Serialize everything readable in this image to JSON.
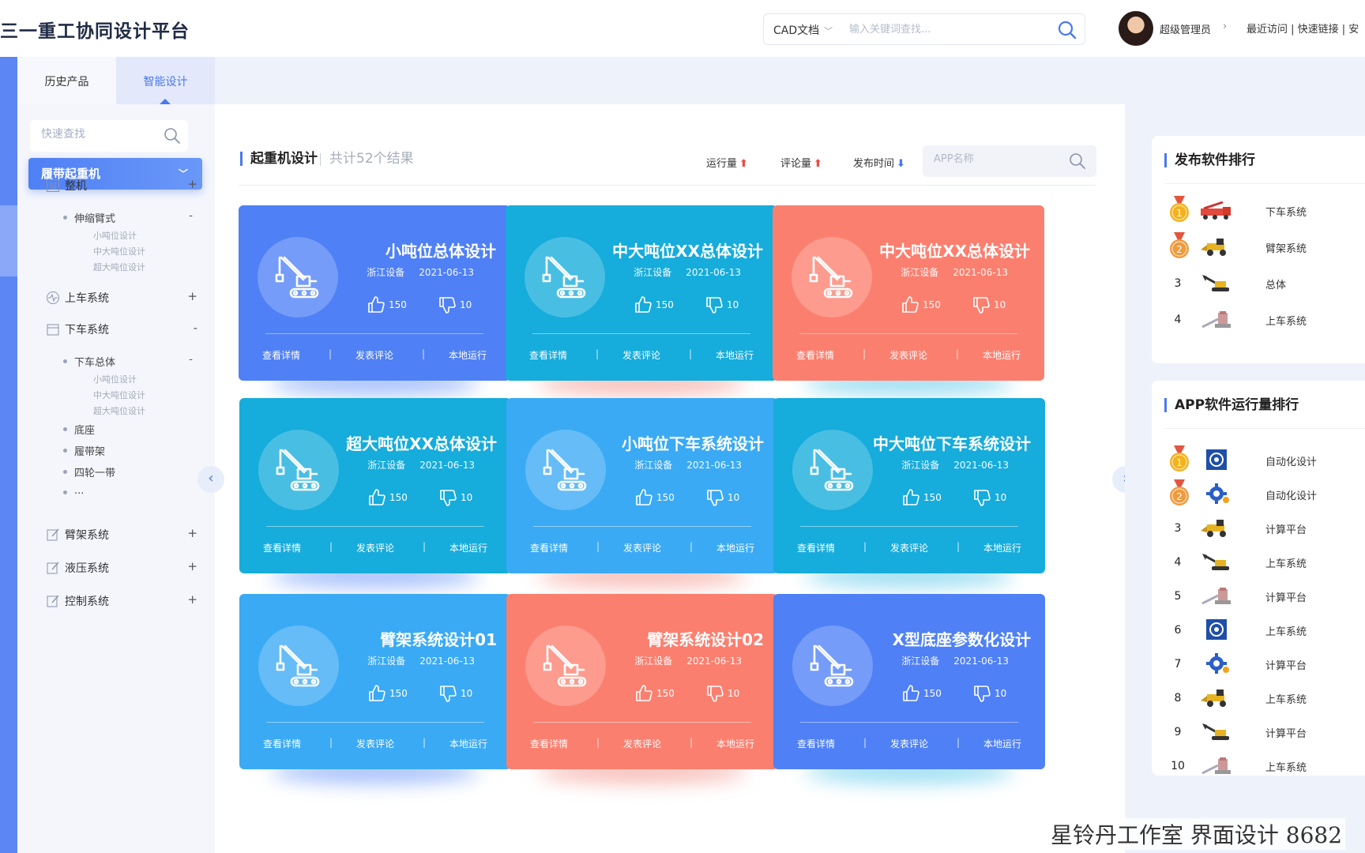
{
  "header": {
    "brand": "三一重工协同设计平台",
    "search_type": "CAD文档",
    "search_placeholder": "输入关键词查找...",
    "user_name": "超级管理员",
    "top_links": "最近访问 | 快速链接 | 安"
  },
  "sidebar": {
    "tabs": [
      {
        "label": "历史产品"
      },
      {
        "label": "智能设计"
      }
    ],
    "quick_search_placeholder": "快速查找",
    "active_category": "履带起重机",
    "groups": [
      {
        "label": "整机",
        "toggle": "+"
      },
      {
        "label": "上车系统",
        "toggle": "+"
      },
      {
        "label": "下车系统",
        "toggle": "-"
      },
      {
        "label": "臂架系统",
        "toggle": "+"
      },
      {
        "label": "液压系统",
        "toggle": "+"
      },
      {
        "label": "控制系统",
        "toggle": "+"
      }
    ],
    "zhengji_sub": {
      "label": "伸缩臂式",
      "toggle": "-",
      "leaves": [
        "小吨位设计",
        "中大吨位设计",
        "超大吨位设计"
      ]
    },
    "xiache_sub": {
      "label": "下车总体",
      "toggle": "-",
      "leaves": [
        "小吨位设计",
        "中大吨位设计",
        "超大吨位设计"
      ]
    },
    "xiache_others": [
      "底座",
      "履带架",
      "四轮一带",
      "..."
    ]
  },
  "main": {
    "section_title": "起重机设计",
    "result_count": "共计52个结果",
    "sorts": [
      {
        "label": "运行量",
        "arrow": "⬆",
        "color": "#f04a3e"
      },
      {
        "label": "评论量",
        "arrow": "⬆",
        "color": "#f04a3e"
      },
      {
        "label": "发布时间",
        "arrow": "⬇",
        "color": "#4a78f0"
      }
    ],
    "app_search_placeholder": "APP名称",
    "action_labels": [
      "查看详情",
      "发表评论",
      "本地运行"
    ],
    "cards": [
      {
        "title": "小吨位总体设计",
        "company": "浙江设备",
        "date": "2021-06-13",
        "likes": "150",
        "dislikes": "10",
        "color": "#4f80f6",
        "shadow": "#5c8cf8"
      },
      {
        "title": "中大吨位XX总体设计",
        "company": "浙江设备",
        "date": "2021-06-13",
        "likes": "150",
        "dislikes": "10",
        "color": "#16acdc",
        "shadow": "#f08a80"
      },
      {
        "title": "中大吨位XX总体设计",
        "company": "浙江设备",
        "date": "2021-06-13",
        "likes": "150",
        "dislikes": "10",
        "color": "#fb7f6f",
        "shadow": "#4cc4e8"
      },
      {
        "title": "超大吨位XX总体设计",
        "company": "浙江设备",
        "date": "2021-06-13",
        "likes": "150",
        "dislikes": "10",
        "color": "#16acdc",
        "shadow": "#5c8cf8"
      },
      {
        "title": "小吨位下车系统设计",
        "company": "浙江设备",
        "date": "2021-06-13",
        "likes": "150",
        "dislikes": "10",
        "color": "#3aaaf5",
        "shadow": "#f08a80"
      },
      {
        "title": "中大吨位下车系统设计",
        "company": "浙江设备",
        "date": "2021-06-13",
        "likes": "150",
        "dislikes": "10",
        "color": "#16acdc",
        "shadow": "#4cc4e8"
      },
      {
        "title": "臂架系统设计01",
        "company": "浙江设备",
        "date": "2021-06-13",
        "likes": "150",
        "dislikes": "10",
        "color": "#3aaaf5",
        "shadow": "#5c8cf8"
      },
      {
        "title": "臂架系统设计02",
        "company": "浙江设备",
        "date": "2021-06-13",
        "likes": "150",
        "dislikes": "10",
        "color": "#fb7f6f",
        "shadow": "#f08a80"
      },
      {
        "title": "X型底座参数化设计",
        "company": "浙江设备",
        "date": "2021-06-13",
        "likes": "150",
        "dislikes": "10",
        "color": "#4f80f6",
        "shadow": "#4cc4e8"
      }
    ]
  },
  "right": {
    "publish_rank": {
      "title": "发布软件排行",
      "rows": [
        {
          "rank": "1",
          "name": "下车系统",
          "thumb": "truck-thumb"
        },
        {
          "rank": "2",
          "name": "臂架系统",
          "thumb": "loader-thumb"
        },
        {
          "rank": "3",
          "name": "总体",
          "thumb": "excavator-thumb"
        },
        {
          "rank": "4",
          "name": "上车系统",
          "thumb": "crane-thumb"
        }
      ]
    },
    "app_rank": {
      "title": "APP软件运行量排行",
      "rows": [
        {
          "rank": "1",
          "name": "自动化设计",
          "thumb": "app-logo-thumb"
        },
        {
          "rank": "2",
          "name": "自动化设计",
          "thumb": "gear-thumb"
        },
        {
          "rank": "3",
          "name": "计算平台",
          "thumb": "loader-thumb"
        },
        {
          "rank": "4",
          "name": "上车系统",
          "thumb": "excavator-thumb"
        },
        {
          "rank": "5",
          "name": "计算平台",
          "thumb": "crane-thumb"
        },
        {
          "rank": "6",
          "name": "上车系统",
          "thumb": "app-logo-thumb"
        },
        {
          "rank": "7",
          "name": "计算平台",
          "thumb": "gear-thumb"
        },
        {
          "rank": "8",
          "name": "上车系统",
          "thumb": "loader-thumb"
        },
        {
          "rank": "9",
          "name": "计算平台",
          "thumb": "excavator-thumb"
        },
        {
          "rank": "10",
          "name": "上车系统",
          "thumb": "crane-thumb"
        }
      ]
    }
  },
  "watermark": "星铃丹工作室 界面设计 8682"
}
